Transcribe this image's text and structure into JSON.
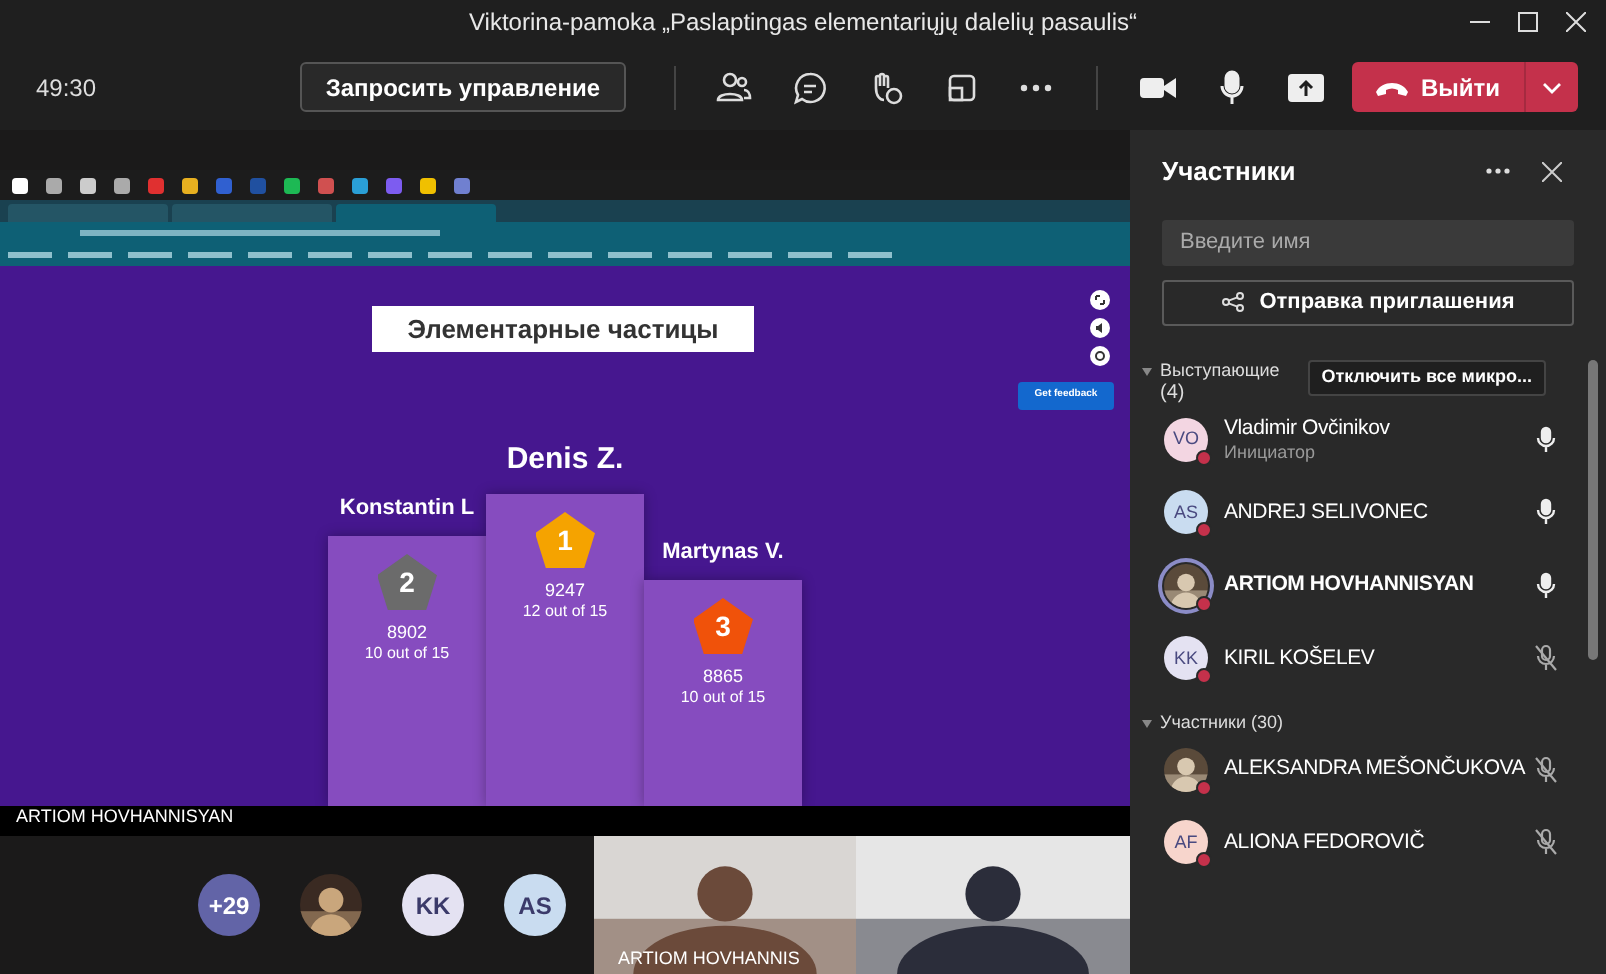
{
  "window": {
    "title": "Viktorina-pamoka „Paslaptingas elementariųjų dalelių pasaulis“"
  },
  "toolbar": {
    "timer": "49:30",
    "request_control": "Запросить управление",
    "leave": "Выйти"
  },
  "shared_screen": {
    "quiz_title": "Элементарные частицы",
    "feedback_button": "Get feedback",
    "presenter": "ARTIOM HOVHANNISYAN",
    "podium": [
      {
        "name": "Konstantin L",
        "rank": "2",
        "score": "8902",
        "correct": "10 out of 15",
        "color": "#6b6b6b"
      },
      {
        "name": "Denis Z.",
        "rank": "1",
        "score": "9247",
        "correct": "12 out of 15",
        "color": "#f5a300"
      },
      {
        "name": "Martynas V.",
        "rank": "3",
        "score": "8865",
        "correct": "10 out of 15",
        "color": "#f0520a"
      }
    ]
  },
  "gallery": [
    {
      "kind": "count",
      "text": "+29"
    },
    {
      "kind": "picture"
    },
    {
      "kind": "initials",
      "text": "KK",
      "color": "#e4e2f2"
    },
    {
      "kind": "initials",
      "text": "AS",
      "color": "#c9dcf0"
    }
  ],
  "videos": [
    {
      "kind": "picture",
      "caption": "ARTIOM HOVHANNIS"
    },
    {
      "kind": "picture"
    }
  ],
  "panel": {
    "title": "Участники",
    "search": {
      "placeholder": "Введите имя"
    },
    "invite": "Отправка приглашения",
    "sections": [
      {
        "title": "Выступающие",
        "count": "(4)",
        "expanded": true,
        "action": "Отключить все микро...",
        "people": [
          {
            "name": "Vladimir Ovčinikov",
            "role": "Инициатор",
            "kind": "initials",
            "initials": "VO",
            "color": "#f3d6e2",
            "muted": false,
            "speaking": false
          },
          {
            "name": "ANDREJ SELIVONEC",
            "kind": "initials",
            "initials": "AS",
            "color": "#c9dcf0",
            "muted": false,
            "speaking": false
          },
          {
            "name": "ARTIOM HOVHANNISYAN",
            "kind": "picture",
            "muted": false,
            "speaking": true
          },
          {
            "name": "KIRIL KOŠELEV",
            "kind": "initials",
            "initials": "KK",
            "color": "#e4e2f2",
            "muted": true,
            "speaking": false
          }
        ]
      },
      {
        "title": "Участники (30)",
        "expanded": true,
        "people": [
          {
            "name": "ALEKSANDRA MEŠONČUKOVA",
            "kind": "picture",
            "muted": true,
            "speaking": false
          },
          {
            "name": "ALIONA FEDOROVIČ",
            "kind": "initials",
            "initials": "AF",
            "color": "#f7d5cc",
            "muted": true,
            "speaking": false
          }
        ]
      }
    ]
  }
}
